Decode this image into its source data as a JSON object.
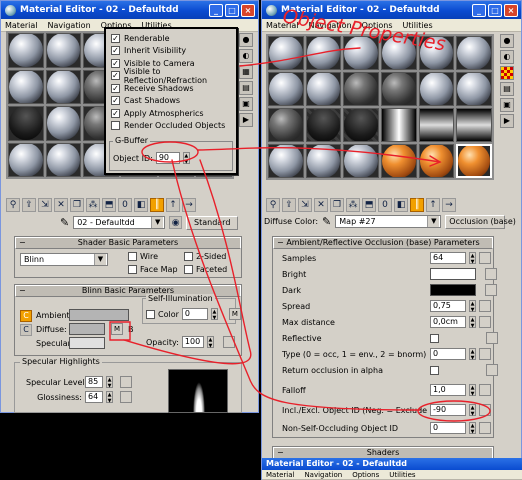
{
  "left_window": {
    "title": "Material Editor - 02 - Defaultdd",
    "menu": [
      "Material",
      "Navigation",
      "Options",
      "Utilities"
    ],
    "material_name": "02 - Defaultdd",
    "type_button": "Standard",
    "shader_rollout": {
      "title": "Shader Basic Parameters",
      "shader": "Blinn",
      "wire": "Wire",
      "two_sided": "2-Sided",
      "face_map": "Face Map",
      "faceted": "Faceted"
    },
    "blinn_rollout": {
      "title": "Blinn Basic Parameters",
      "self_illum_title": "Self-Illumination",
      "ambient": "Ambient:",
      "diffuse": "Diffuse:",
      "specular": "Specular:",
      "color_label": "Color",
      "color_value": "0",
      "opacity_label": "Opacity:",
      "opacity_value": "100",
      "m": "M",
      "b": "B"
    },
    "specular_highlights": {
      "title": "Specular Highlights",
      "specular_level_label": "Specular Level:",
      "specular_level": "85",
      "glossiness_label": "Glossiness:",
      "glossiness": "64"
    }
  },
  "popup": {
    "items": [
      {
        "label": "Renderable",
        "checked": true
      },
      {
        "label": "Inherit Visibility",
        "checked": true
      },
      {
        "label": "Visible to Camera",
        "checked": true
      },
      {
        "label": "Visible to Reflection/Refraction",
        "checked": true
      },
      {
        "label": "Receive Shadows",
        "checked": true
      },
      {
        "label": "Cast Shadows",
        "checked": true
      },
      {
        "label": "Apply Atmospherics",
        "checked": true
      },
      {
        "label": "Render Occluded Objects",
        "checked": false
      }
    ],
    "gbuffer_title": "G-Buffer",
    "object_id_label": "Object ID:",
    "object_id_value": "90"
  },
  "right_window": {
    "title": "Material Editor - 02 - Defaultdd",
    "menu": [
      "Material",
      "Navigation",
      "Options",
      "Utilities"
    ],
    "diffuse_color_label": "Diffuse Color:",
    "map_name": "Map #27",
    "type_button": "Occlusion (base)",
    "rollout_title": "Ambient/Reflective Occlusion (base) Parameters",
    "params": [
      {
        "label": "Samples",
        "value": "64"
      },
      {
        "label": "Bright",
        "value": ""
      },
      {
        "label": "Dark",
        "value": ""
      },
      {
        "label": "Spread",
        "value": "0,75"
      },
      {
        "label": "Max distance",
        "value": "0,0cm"
      },
      {
        "label": "Reflective",
        "value": ""
      },
      {
        "label": "Type (0 = occ, 1 = env., 2 = bnorm)",
        "value": "0"
      },
      {
        "label": "Return occlusion in alpha",
        "value": ""
      },
      {
        "label": "Falloff",
        "value": "1,0"
      },
      {
        "label": "Incl./Excl. Object ID (Neg. = Exclude)",
        "value": "-90"
      },
      {
        "label": "Non-Self-Occluding Object ID",
        "value": "0"
      }
    ],
    "shaders_title": "Shaders",
    "bottom_title": "Material Editor - 02 - Defaultdd",
    "bottom_menu": [
      "Material",
      "Navigation",
      "Options",
      "Utilities"
    ],
    "samples_label": "Samples"
  },
  "annotation": {
    "text": "Object Properties",
    "color": "#e8202a"
  }
}
